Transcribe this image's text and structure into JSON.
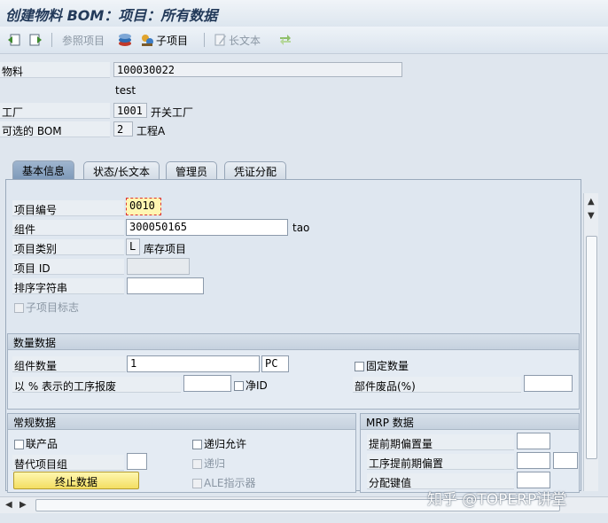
{
  "window": {
    "title": "创建物料 BOM：项目：所有数据"
  },
  "toolbar": {
    "ref_item_label": "参照项目",
    "sub_item_label": "子项目",
    "long_text_label": "长文本"
  },
  "header": {
    "material_label": "物料",
    "material_value": "100030022",
    "material_desc": "test",
    "plant_label": "工厂",
    "plant_value": "1001",
    "plant_desc": "开关工厂",
    "alt_bom_label": "可选的 BOM",
    "alt_bom_value": "2",
    "alt_bom_desc": "工程A"
  },
  "tabs": [
    {
      "label": "基本信息",
      "active": true
    },
    {
      "label": "状态/长文本",
      "active": false
    },
    {
      "label": "管理员",
      "active": false
    },
    {
      "label": "凭证分配",
      "active": false
    }
  ],
  "item": {
    "item_no_label": "项目编号",
    "item_no_value": "0010",
    "component_label": "组件",
    "component_value": "300050165",
    "component_desc": "tao",
    "category_label": "项目类别",
    "category_value": "L",
    "category_desc": "库存项目",
    "item_id_label": "项目 ID",
    "item_id_value": "",
    "sort_label": "排序字符串",
    "sort_value": "",
    "sub_item_flag_label": "子项目标志"
  },
  "quantity": {
    "header": "数量数据",
    "qty_label": "组件数量",
    "qty_value": "1",
    "unit_value": "PC",
    "fixed_qty_label": "固定数量",
    "scrap_label": "以 % 表示的工序报废",
    "scrap_value": "",
    "net_id_label": "净ID",
    "comp_scrap_label": "部件废品(%)",
    "comp_scrap_value": ""
  },
  "general": {
    "header": "常规数据",
    "co_product_label": "联产品",
    "alt_group_label": "替代项目组",
    "alt_group_value": "",
    "end_data_button": "终止数据",
    "recursive_allowed_label": "递归允许",
    "recursive_label": "递归",
    "ale_label": "ALE指示器"
  },
  "mrp": {
    "header": "MRP 数据",
    "lead_offset_label": "提前期偏置量",
    "lead_offset_value": "",
    "op_lead_offset_label": "工序提前期偏置",
    "op_lead_offset_value": "",
    "dist_key_label": "分配键值",
    "dist_key_value": ""
  },
  "watermark": "知乎 @TOPERP讲堂"
}
